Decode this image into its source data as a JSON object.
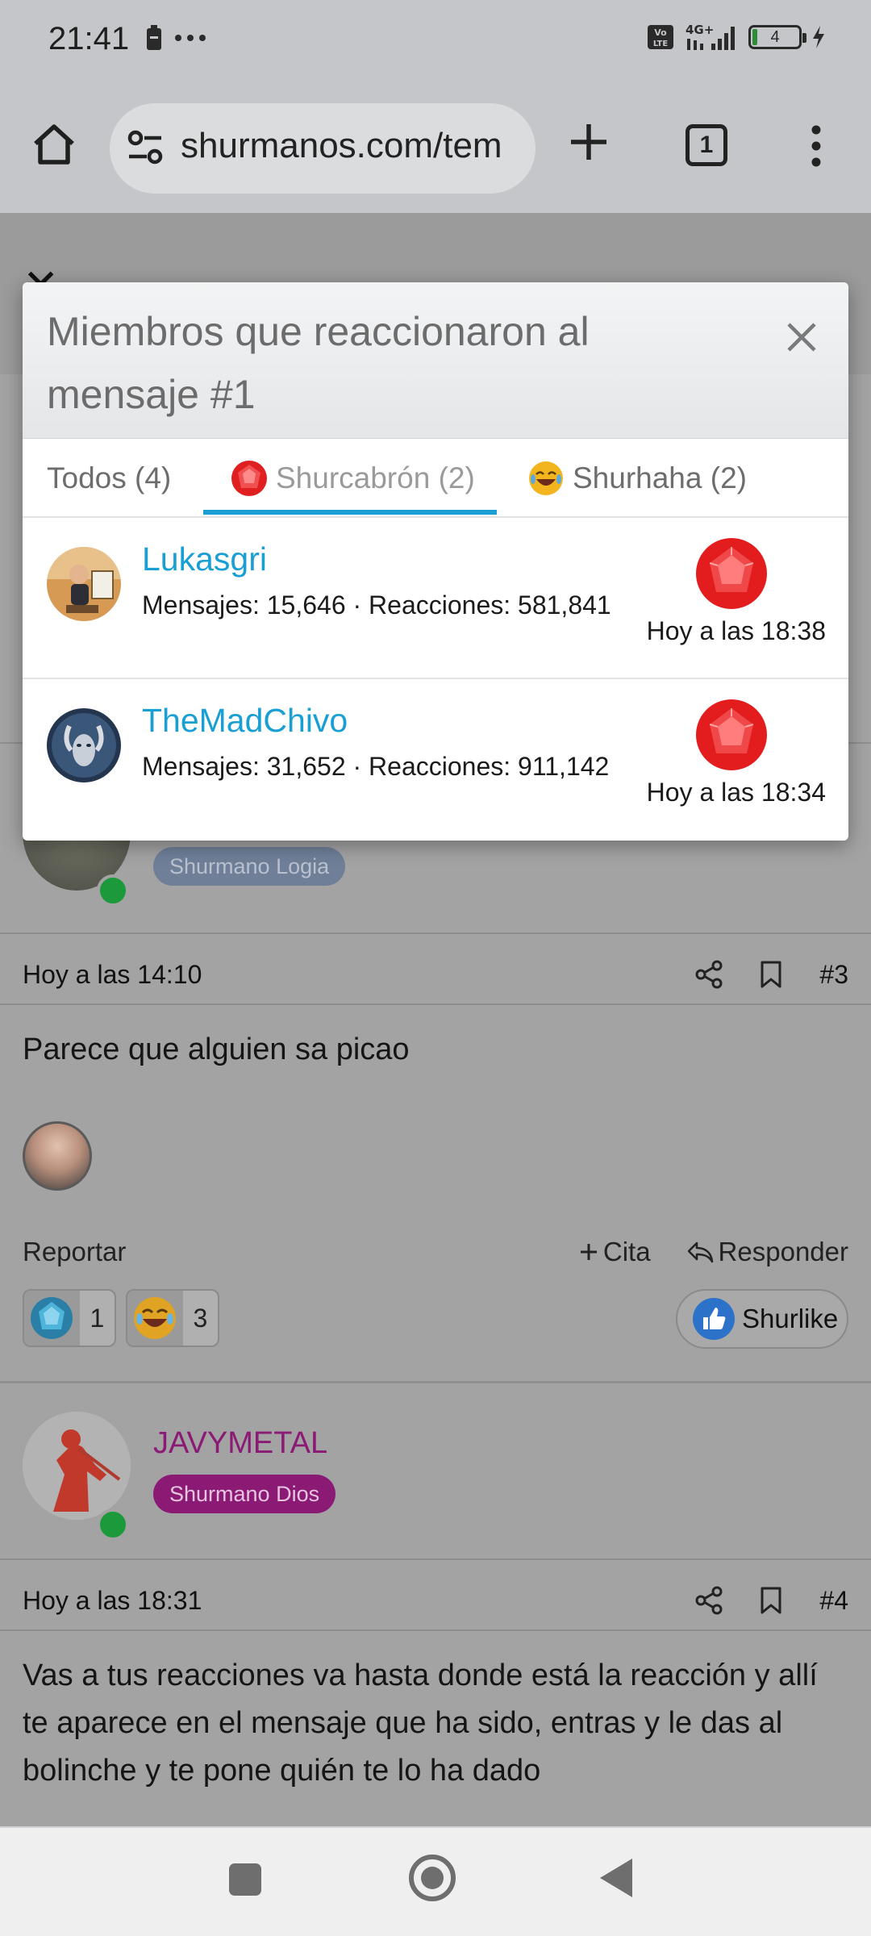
{
  "status_bar": {
    "time": "21:41",
    "battery_level": "4",
    "network": "4G+",
    "volte": "Vo LTE"
  },
  "browser": {
    "url": "shurmanos.com/tem",
    "tab_count": "1"
  },
  "modal": {
    "title": "Miembros que reaccionaron al mensaje #1",
    "tabs": [
      {
        "label": "Todos (4)"
      },
      {
        "label": "Shurcabrón (2)"
      },
      {
        "label": "Shurhaha (2)"
      }
    ],
    "members": [
      {
        "name": "Lukasgri",
        "stats": "Mensajes: 15,646 · Reacciones: 581,841",
        "when": "Hoy a las 18:38"
      },
      {
        "name": "TheMadChivo",
        "stats": "Mensajes: 31,652 · Reacciones: 911,142",
        "when": "Hoy a las 18:34"
      }
    ]
  },
  "post3": {
    "role": "Shurmano Logia",
    "time": "Hoy a las 14:10",
    "number": "#3",
    "text": "Parece que alguien sa picao",
    "report": "Reportar",
    "quote": "Cita",
    "reply": "Responder",
    "reactions": [
      {
        "icon": "gem-blue-icon",
        "count": "1"
      },
      {
        "icon": "laugh-icon",
        "count": "3"
      }
    ],
    "like_label": "Shurlike"
  },
  "post4": {
    "author": "JAVYMETAL",
    "role": "Shurmano Dios",
    "time": "Hoy a las 18:31",
    "number": "#4",
    "text": "Vas a tus reacciones va hasta donde está la reacción y allí te aparece en el mensaje que ha sido, entras y le das al bolinche y te pone quién te lo ha dado"
  },
  "colors": {
    "accent_blue": "#1a9fd4",
    "author_purple": "#8a1a74",
    "online_green": "#1c9a3b"
  }
}
